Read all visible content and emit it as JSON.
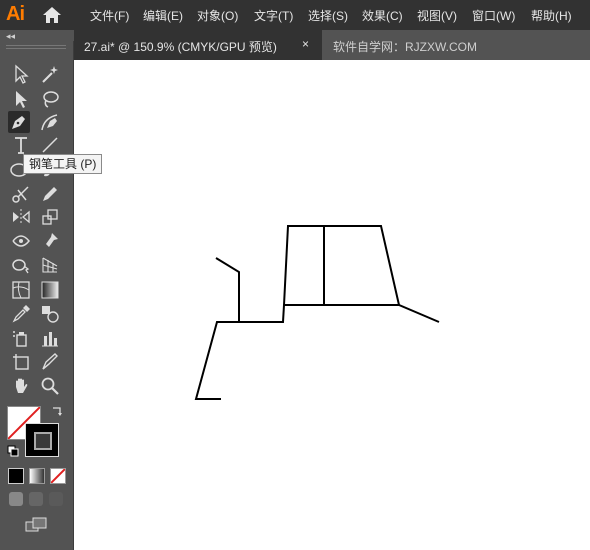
{
  "app": {
    "logo": "Ai",
    "logo_color": "#ff7c00"
  },
  "menu": [
    "文件(F)",
    "编辑(E)",
    "对象(O)",
    "文字(T)",
    "选择(S)",
    "效果(C)",
    "视图(V)",
    "窗口(W)",
    "帮助(H)"
  ],
  "tabs": {
    "collapse": "◂◂",
    "active": {
      "label": "27.ai* @ 150.9% (CMYK/GPU 预览)",
      "close": "×"
    },
    "inactive": {
      "label": "软件自学网：RJZXW.COM"
    }
  },
  "tooltip": {
    "text": "钢笔工具 (P)"
  },
  "tools": [
    "selection-tool",
    "magic-wand-tool",
    "direct-selection-tool",
    "lasso-tool",
    "pen-tool",
    "curvature-tool",
    "type-tool",
    "line-segment-tool",
    "ellipse-tool",
    "paintbrush-tool",
    "scissors-tool",
    "pencil-tool",
    "reflect-tool",
    "scale-tool",
    "width-tool",
    "puppet-warp-tool",
    "shape-builder-tool",
    "perspective-grid-tool",
    "mesh-tool",
    "gradient-tool",
    "eyedropper-tool",
    "blend-tool",
    "symbol-sprayer-tool",
    "column-graph-tool",
    "artboard-tool",
    "slice-tool",
    "hand-tool",
    "zoom-tool"
  ],
  "colors": {
    "fill": "none",
    "stroke": "#000000",
    "ui_dark": "#323232",
    "ui_mid": "#535353"
  }
}
